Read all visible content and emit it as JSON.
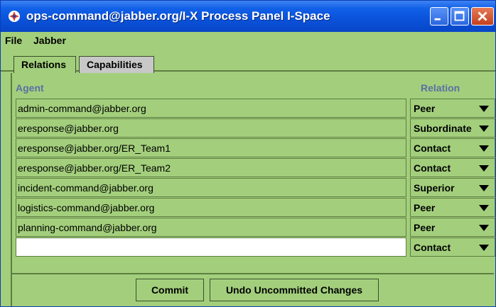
{
  "window": {
    "title": "ops-command@jabber.org/I-X Process Panel I-Space",
    "icon": "ix-logo-icon",
    "controls": [
      "minimize-icon",
      "maximize-icon",
      "close-icon"
    ]
  },
  "menu": {
    "items": [
      {
        "label": "File"
      },
      {
        "label": "Jabber"
      }
    ]
  },
  "tabs": [
    {
      "label": "Relations",
      "active": true
    },
    {
      "label": "Capabilities",
      "active": false
    }
  ],
  "table": {
    "columns": {
      "agent": "Agent",
      "relation": "Relation"
    },
    "rows": [
      {
        "agent": "admin-command@jabber.org",
        "relation": "Peer"
      },
      {
        "agent": "eresponse@jabber.org",
        "relation": "Subordinate"
      },
      {
        "agent": "eresponse@jabber.org/ER_Team1",
        "relation": "Contact"
      },
      {
        "agent": "eresponse@jabber.org/ER_Team2",
        "relation": "Contact"
      },
      {
        "agent": "incident-command@jabber.org",
        "relation": "Superior"
      },
      {
        "agent": "logistics-command@jabber.org",
        "relation": "Peer"
      },
      {
        "agent": "planning-command@jabber.org",
        "relation": "Peer"
      },
      {
        "agent": "",
        "relation": "Contact"
      }
    ]
  },
  "buttons": {
    "commit": "Commit",
    "undo": "Undo Uncommitted Changes"
  },
  "colors": {
    "background": "#a3cf7c",
    "titlebar": "#0a52d9",
    "header_text": "#5c6fa3"
  }
}
